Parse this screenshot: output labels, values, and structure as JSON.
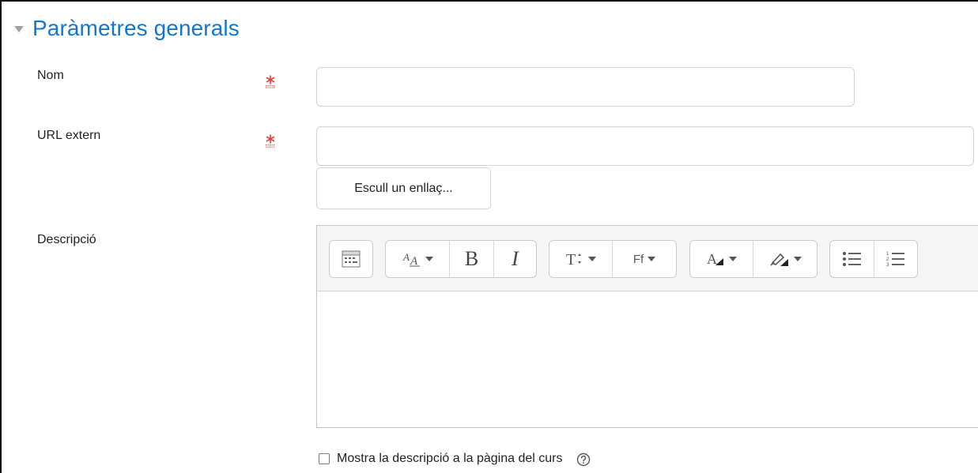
{
  "section": {
    "title": "Paràmetres generals",
    "collapse_icon": "caret-down-icon"
  },
  "fields": {
    "name": {
      "label": "Nom",
      "value": "",
      "required_icon": "required-asterisk-icon"
    },
    "url": {
      "label": "URL extern",
      "value": "",
      "required_icon": "required-asterisk-icon"
    },
    "choose_link_label": "Escull un enllaç...",
    "description": {
      "label": "Descripció"
    }
  },
  "toolbar": {
    "icons": [
      "toolbar-toggle-icon",
      "font-size-icon",
      "bold-icon",
      "italic-icon",
      "paragraph-style-icon",
      "font-family-icon",
      "text-color-icon",
      "background-color-icon",
      "unordered-list-icon",
      "ordered-list-icon"
    ],
    "bold_glyph": "B",
    "italic_glyph": "I",
    "font_family_glyph": "Ff"
  },
  "show_description": {
    "label": "Mostra la descripció a la pàgina del curs",
    "checked": false,
    "help_icon": "help-icon"
  },
  "colors": {
    "accent": "#1177d1",
    "required": "#e0403a",
    "border": "#ced4da"
  }
}
